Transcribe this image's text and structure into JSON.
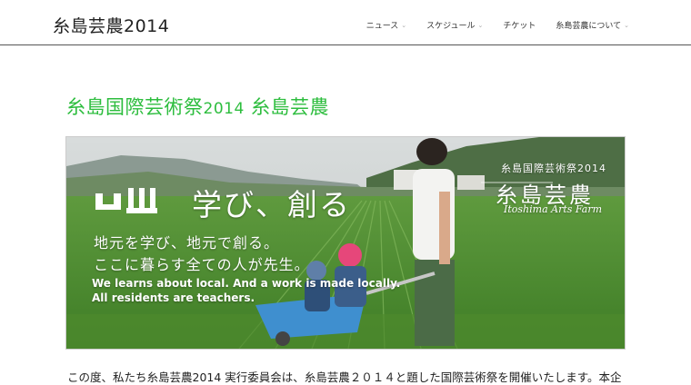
{
  "header": {
    "site_title": "糸島芸農2014",
    "nav": [
      {
        "label": "ニュース",
        "has_dropdown": true
      },
      {
        "label": "スケジュール",
        "has_dropdown": true
      },
      {
        "label": "チケット",
        "has_dropdown": false
      },
      {
        "label": "糸島芸農について",
        "has_dropdown": true
      }
    ]
  },
  "main": {
    "title_main": "糸島国際芸術祭",
    "title_year": "2014",
    "title_suffix": " 糸島芸農",
    "hero": {
      "tagline": "学び、創る",
      "jp_line1": "地元を学び、地元で創る。",
      "jp_line2": "ここに暮らす全ての人が先生。",
      "en_line1": "We learns about local. And a work is made locally.",
      "en_line2": "All residents are teachers.",
      "fest_small": "糸島国際芸術祭2014",
      "fest_big": "糸島芸農",
      "fest_en": "Itoshima Arts Farm"
    },
    "body_text": "この度、私たち糸島芸農2014 実行委員会は、糸島芸農２０１４と題した国際芸術祭を開催いたします。本企"
  },
  "colors": {
    "accent": "#2dbd3e",
    "header_border": "#555555"
  },
  "icons": {
    "chevron": "chevron-down-icon"
  }
}
